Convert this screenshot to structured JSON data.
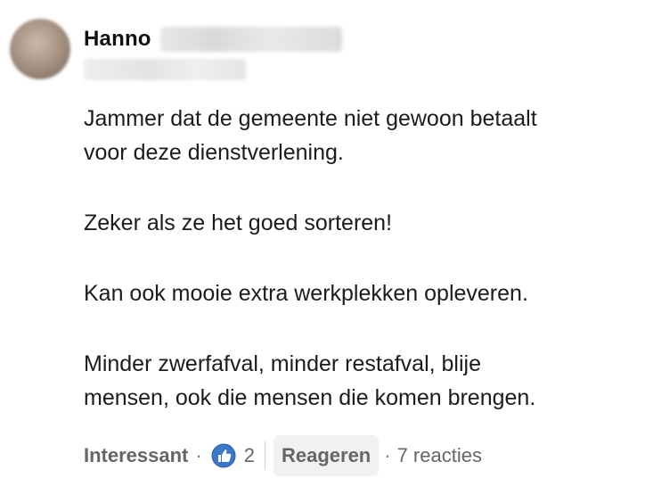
{
  "comment": {
    "author": "Hanno",
    "body": [
      [
        "Jammer dat de gemeente niet gewoon betaalt",
        "voor deze dienstverlening."
      ],
      [
        "Zeker als ze het goed sorteren!"
      ],
      [
        "Kan ook mooie extra werkplekken opleveren."
      ],
      [
        "Minder zwerfafval, minder restafval, blije",
        "mensen, ook die mensen die komen brengen."
      ]
    ]
  },
  "actions": {
    "reaction_label": "Interessant",
    "separator": "·",
    "reaction_icon": "thumbs-up-icon",
    "reaction_count": "2",
    "reply_label": "Reageren",
    "replies_count": "7 reacties"
  },
  "colors": {
    "reaction_icon": "#3b78c9",
    "secondary_text": "#666666",
    "reply_button_bg": "#f1f1f1"
  }
}
